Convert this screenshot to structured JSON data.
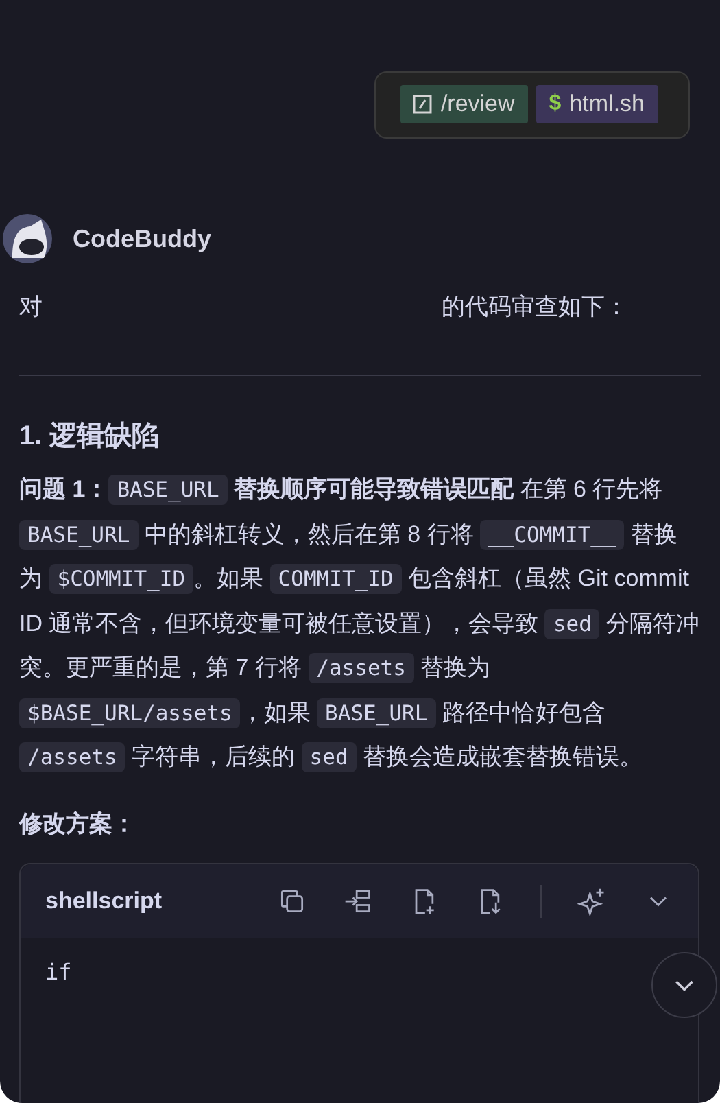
{
  "context_chips": [
    {
      "kind": "command",
      "label": "/review"
    },
    {
      "kind": "file",
      "icon": "$",
      "label": "html.sh"
    }
  ],
  "assistant": {
    "name": "CodeBuddy"
  },
  "intro": {
    "before": "对",
    "after": "的代码审查如下："
  },
  "section_heading": "1. 逻辑缺陷",
  "issue_paragraph": [
    {
      "kind": "bold",
      "text": "问题 1："
    },
    {
      "kind": "code",
      "text": "BASE_URL"
    },
    {
      "kind": "bold",
      "text": " 替换顺序可能导致错误匹配"
    },
    {
      "kind": "text",
      "text": " 在第 6 行先将 "
    },
    {
      "kind": "code",
      "text": "BASE_URL"
    },
    {
      "kind": "text",
      "text": " 中的斜杠转义，然后在第 8 行将 "
    },
    {
      "kind": "code",
      "text": "__COMMIT__"
    },
    {
      "kind": "text",
      "text": " 替换为 "
    },
    {
      "kind": "code",
      "text": "$COMMIT_ID"
    },
    {
      "kind": "text",
      "text": "。如果 "
    },
    {
      "kind": "code",
      "text": "COMMIT_ID"
    },
    {
      "kind": "text",
      "text": " 包含斜杠（虽然 Git commit ID 通常不含，但环境变量可被任意设置），会导致 "
    },
    {
      "kind": "code",
      "text": "sed"
    },
    {
      "kind": "text",
      "text": " 分隔符冲突。更严重的是，第 7 行将 "
    },
    {
      "kind": "code",
      "text": "/assets"
    },
    {
      "kind": "text",
      "text": " 替换为 "
    },
    {
      "kind": "code",
      "text": "$BASE_URL/assets"
    },
    {
      "kind": "text",
      "text": "，如果 "
    },
    {
      "kind": "code",
      "text": "BASE_URL"
    },
    {
      "kind": "text",
      "text": " 路径中恰好包含 "
    },
    {
      "kind": "code",
      "text": "/assets"
    },
    {
      "kind": "text",
      "text": " 字符串，后续的 "
    },
    {
      "kind": "code",
      "text": "sed"
    },
    {
      "kind": "text",
      "text": " 替换会造成嵌套替换错误。"
    }
  ],
  "fix_heading": "修改方案：",
  "code_block": {
    "language": "shellscript",
    "lines": [
      "if"
    ]
  }
}
